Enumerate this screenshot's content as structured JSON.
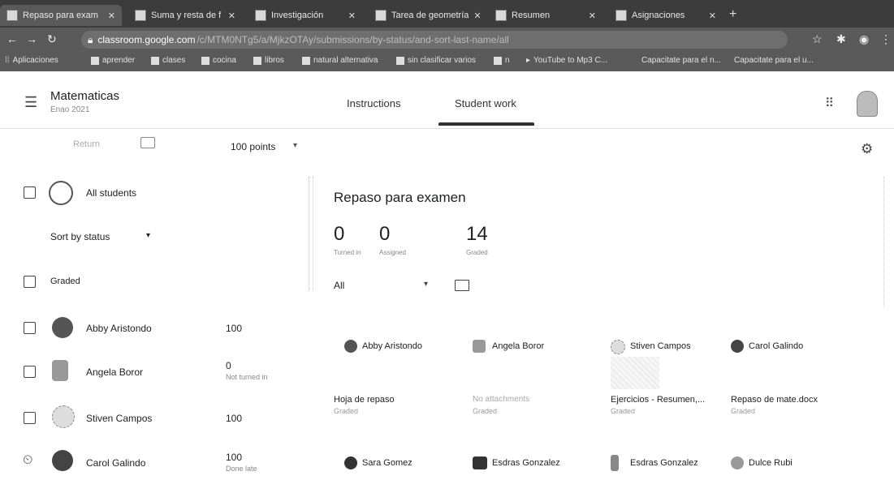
{
  "browser": {
    "tabs": [
      {
        "title": "Repaso para exam"
      },
      {
        "title": "Suma y resta de f"
      },
      {
        "title": "Investigación"
      },
      {
        "title": "Tarea de geometría"
      },
      {
        "title": "Resumen"
      },
      {
        "title": "Asignaciones"
      }
    ],
    "url_host": "classroom.google.com",
    "url_rest": "/c/MTM0NTg5/a/MjkzOTAy/submissions/by-status/and-sort-last-name/all",
    "bookmarks": [
      "Aplicaciones",
      "aprender",
      "clases",
      "cocina",
      "libros",
      "natural alternativa",
      "sin clasificar varios",
      "n",
      "YouTube to Mp3 C...",
      "Capacitate para el n...",
      "Capacitate para el u..."
    ]
  },
  "header": {
    "course_title": "Matematicas",
    "course_subtitle": "Enao 2021",
    "tabs": {
      "instructions": "Instructions",
      "student_work": "Student work"
    }
  },
  "toolbar": {
    "return_label": "Return",
    "points": "100 points"
  },
  "left": {
    "all_students": "All students",
    "sort_label": "Sort by status",
    "group_label": "Graded",
    "students": [
      {
        "name": "Abby Aristondo",
        "score": "100",
        "status": ""
      },
      {
        "name": "Angela Boror",
        "score": "0",
        "status": "Not turned in"
      },
      {
        "name": "Stiven Campos",
        "score": "100",
        "status": ""
      },
      {
        "name": "Carol Galindo",
        "score": "100",
        "status": "Done late"
      }
    ]
  },
  "right": {
    "assignment_title": "Repaso para examen",
    "stats": [
      {
        "value": "0",
        "label": "Turned in"
      },
      {
        "value": "0",
        "label": "Assigned"
      },
      {
        "value": "14",
        "label": "Graded"
      }
    ],
    "filter_value": "All",
    "cards_row1": [
      {
        "name": "Abby Aristondo",
        "file": "Hoja de repaso",
        "status": "Graded"
      },
      {
        "name": "Angela Boror",
        "file": "No attachments",
        "status": "Graded"
      },
      {
        "name": "Stiven Campos",
        "file": "Ejercicios - Resumen,...",
        "status": "Graded"
      },
      {
        "name": "Carol Galindo",
        "file": "Repaso de mate.docx",
        "status": "Graded"
      }
    ],
    "cards_row2": [
      {
        "name": "Sara Gomez"
      },
      {
        "name": "Esdras Gonzalez"
      },
      {
        "name": "Esdras Gonzalez"
      },
      {
        "name": "Dulce Rubi"
      }
    ]
  },
  "icons": {
    "menu": "hamburger-icon",
    "apps": "apps-grid-icon",
    "settings": "gear-icon",
    "folder": "folder-icon",
    "mail": "mail-icon"
  }
}
